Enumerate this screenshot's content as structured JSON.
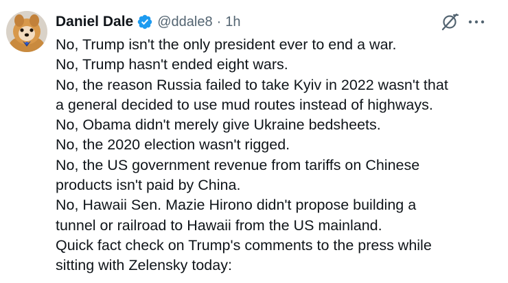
{
  "author": {
    "display_name": "Daniel Dale",
    "handle": "@ddale8",
    "separator": "·",
    "timestamp": "1h",
    "avatar_icon": "dog-avatar",
    "verified_icon": "verified-badge-icon",
    "verified_color": "#1d9bf0"
  },
  "actions": {
    "grok_icon": "grok-icon",
    "more_icon": "more-options-icon"
  },
  "tweet": {
    "lines": [
      "No, Trump isn't the only president ever to end a war.",
      "No, Trump hasn't ended eight wars.",
      "No, the reason Russia failed to take Kyiv in 2022 wasn't that",
      "a general decided to use mud routes instead of highways.",
      "No, Obama didn't merely give Ukraine bedsheets.",
      "No, the 2020 election wasn't rigged.",
      "No, the US government revenue from tariffs on Chinese",
      "products isn't paid by China.",
      "No, Hawaii Sen. Mazie Hirono didn't propose building a",
      "tunnel or railroad to Hawaii from the US mainland.",
      "Quick fact check on Trump's comments to the press while",
      "sitting with Zelensky today:"
    ]
  },
  "colors": {
    "text_primary": "#0f1419",
    "text_secondary": "#536471",
    "background": "#ffffff"
  }
}
